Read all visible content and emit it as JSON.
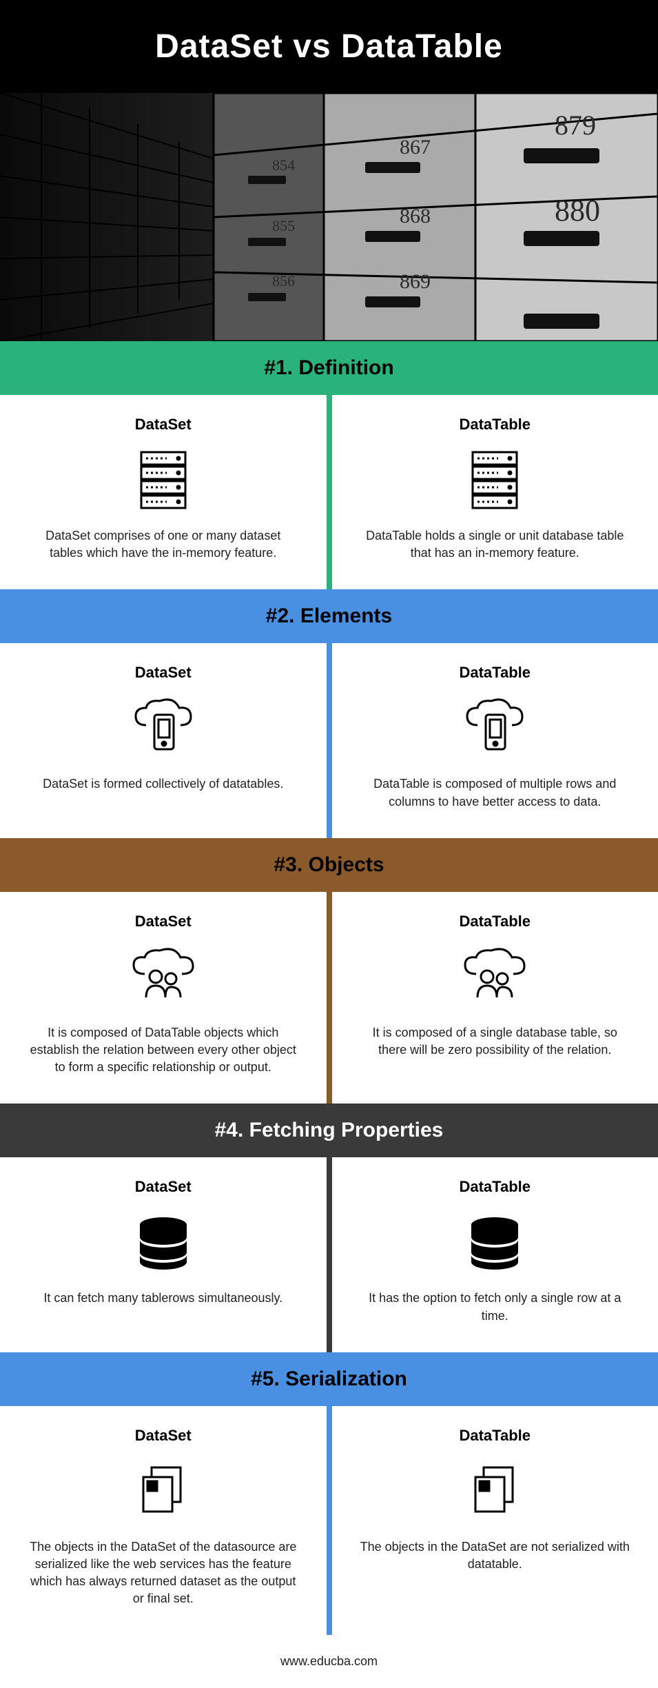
{
  "title": "DataSet vs DataTable",
  "footer": "www.educba.com",
  "sections": [
    {
      "header": "#1. Definition",
      "left_title": "DataSet",
      "right_title": "DataTable",
      "left_text": "DataSet comprises of one or many dataset tables which have the in-memory feature.",
      "right_text": "DataTable holds a single or unit database table that has an in-memory feature."
    },
    {
      "header": "#2. Elements",
      "left_title": "DataSet",
      "right_title": "DataTable",
      "left_text": "DataSet is formed collectively of datatables.",
      "right_text": "DataTable is composed of multiple rows and columns to have better access to data."
    },
    {
      "header": "#3. Objects",
      "left_title": "DataSet",
      "right_title": "DataTable",
      "left_text": "It is composed of DataTable objects which establish the relation between every other object to form a specific relationship or output.",
      "right_text": "It is composed of a single database table, so there will be zero possibility of the relation."
    },
    {
      "header": "#4. Fetching Properties",
      "left_title": "DataSet",
      "right_title": "DataTable",
      "left_text": "It can fetch many tablerows simultaneously.",
      "right_text": "It has the option to fetch only a single row at a time."
    },
    {
      "header": "#5. Serialization",
      "left_title": "DataSet",
      "right_title": "DataTable",
      "left_text": "The objects in the DataSet of the datasource are serialized like the web services has the feature which has always returned dataset as the output or final set.",
      "right_text": "The objects in the DataSet are not serialized with datatable."
    }
  ]
}
